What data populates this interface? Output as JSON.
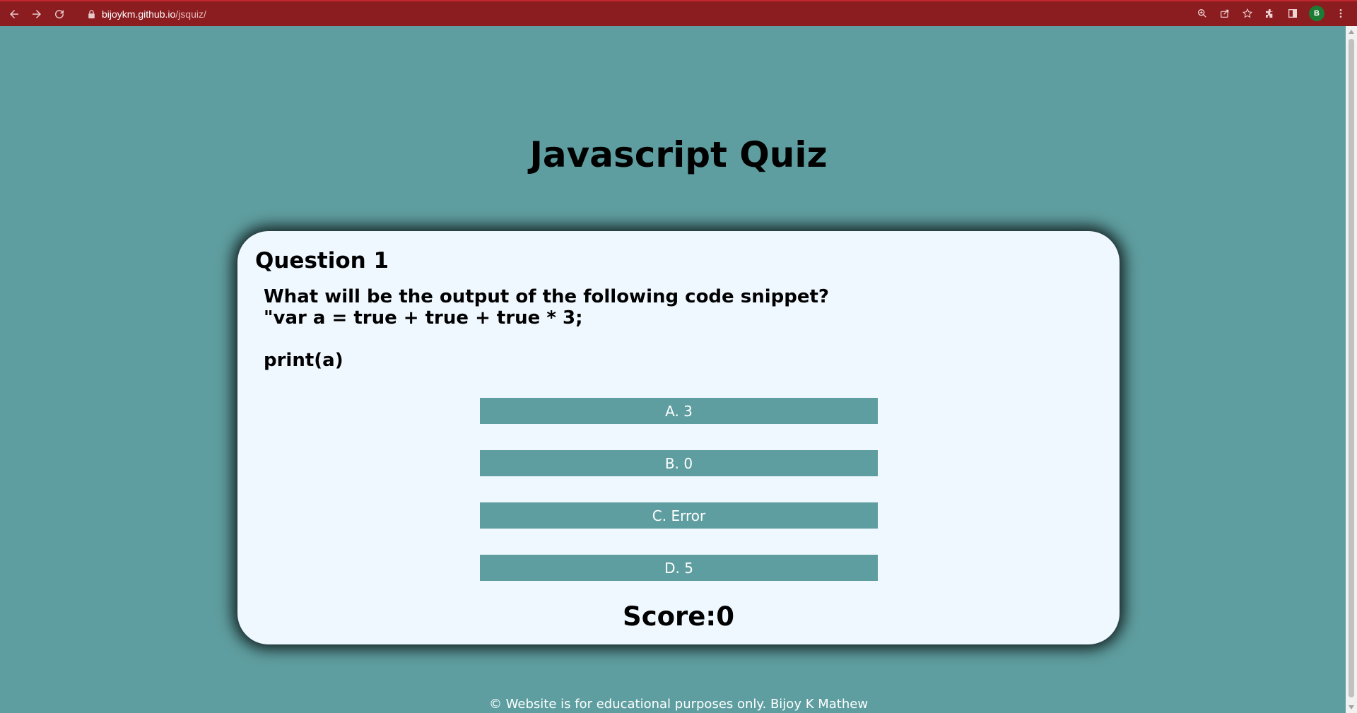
{
  "browser": {
    "url_host": "bijoykm.github.io",
    "url_path": "/jsquiz/",
    "avatar_letter": "B",
    "icons": [
      "back-icon",
      "forward-icon",
      "reload-icon",
      "lock-icon",
      "zoom-icon",
      "share-icon",
      "star-icon",
      "extensions-icon",
      "sidepanel-icon",
      "menu-icon"
    ]
  },
  "page": {
    "title": "Javascript Quiz",
    "question_heading": "Question 1",
    "question_text": "What will be the output of the following code snippet?\n\"var a = true + true + true * 3;\n\nprint(a)",
    "answers": [
      {
        "label": "A. 3"
      },
      {
        "label": "B. 0"
      },
      {
        "label": "C. Error"
      },
      {
        "label": "D. 5"
      }
    ],
    "score_label": "Score:",
    "score_value": "0",
    "footer": "© Website is for educational purposes only. Bijoy K Mathew"
  },
  "colors": {
    "background": "#5f9ea0",
    "card": "#f0f8ff",
    "browser_bar": "#8b1c20"
  }
}
